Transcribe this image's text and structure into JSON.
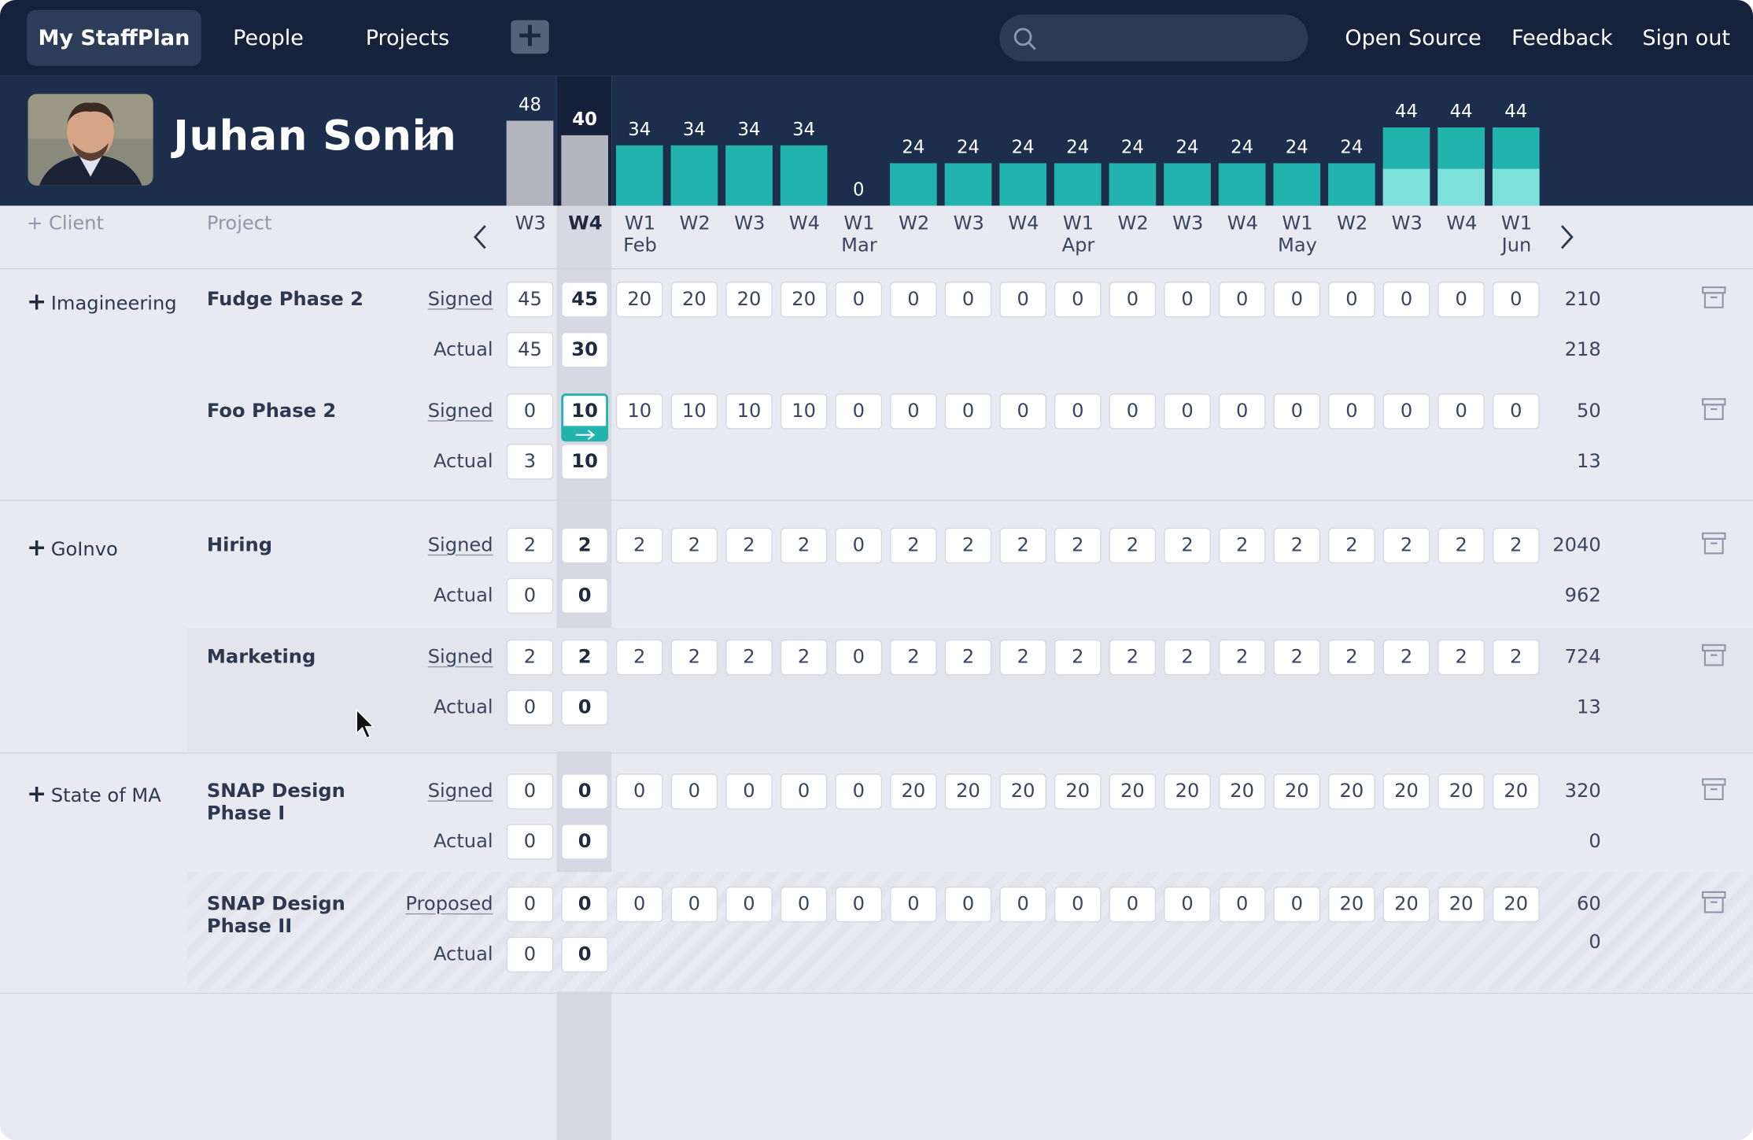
{
  "nav": {
    "home": "My StaffPlan",
    "people": "People",
    "projects": "Projects",
    "open_source": "Open Source",
    "feedback": "Feedback",
    "sign_out": "Sign out",
    "search_placeholder": ""
  },
  "user": {
    "name": "Juhan Sonin"
  },
  "weeks": [
    {
      "label": "W3",
      "month": "",
      "total": 48,
      "state": "past"
    },
    {
      "label": "W4",
      "month": "",
      "total": 40,
      "state": "current"
    },
    {
      "label": "W1",
      "month": "Feb",
      "total": 34,
      "state": "future"
    },
    {
      "label": "W2",
      "month": "",
      "total": 34,
      "state": "future"
    },
    {
      "label": "W3",
      "month": "",
      "total": 34,
      "state": "future"
    },
    {
      "label": "W4",
      "month": "",
      "total": 34,
      "state": "future"
    },
    {
      "label": "W1",
      "month": "Mar",
      "total": 0,
      "state": "future"
    },
    {
      "label": "W2",
      "month": "",
      "total": 24,
      "state": "future"
    },
    {
      "label": "W3",
      "month": "",
      "total": 24,
      "state": "future"
    },
    {
      "label": "W4",
      "month": "",
      "total": 24,
      "state": "future"
    },
    {
      "label": "W1",
      "month": "Apr",
      "total": 24,
      "state": "future"
    },
    {
      "label": "W2",
      "month": "",
      "total": 24,
      "state": "future"
    },
    {
      "label": "W3",
      "month": "",
      "total": 24,
      "state": "future"
    },
    {
      "label": "W4",
      "month": "",
      "total": 24,
      "state": "future"
    },
    {
      "label": "W1",
      "month": "May",
      "total": 24,
      "state": "future"
    },
    {
      "label": "W2",
      "month": "",
      "total": 24,
      "state": "future"
    },
    {
      "label": "W3",
      "month": "",
      "total": 44,
      "state": "proposed"
    },
    {
      "label": "W4",
      "month": "",
      "total": 44,
      "state": "proposed"
    },
    {
      "label": "W1",
      "month": "Jun",
      "total": 44,
      "state": "proposed"
    }
  ],
  "headers": {
    "client": "Client",
    "project": "Project"
  },
  "clients": [
    {
      "name": "Imagineering",
      "projects": [
        {
          "name": "Fudge Phase 2",
          "kind": "Signed",
          "values": [
            "45",
            "45",
            "20",
            "20",
            "20",
            "20",
            "0",
            "0",
            "0",
            "0",
            "0",
            "0",
            "0",
            "0",
            "0",
            "0",
            "0",
            "0",
            "0"
          ],
          "total": "210",
          "actual": [
            "45",
            "30"
          ],
          "actual_total": "218"
        },
        {
          "name": "Foo Phase 2",
          "kind": "Signed",
          "values": [
            "0",
            "10",
            "10",
            "10",
            "10",
            "10",
            "0",
            "0",
            "0",
            "0",
            "0",
            "0",
            "0",
            "0",
            "0",
            "0",
            "0",
            "0",
            "0"
          ],
          "total": "50",
          "actual": [
            "3",
            "10"
          ],
          "actual_total": "13"
        }
      ]
    },
    {
      "name": "GoInvo",
      "projects": [
        {
          "name": "Hiring",
          "kind": "Signed",
          "values": [
            "2",
            "2",
            "2",
            "2",
            "2",
            "2",
            "0",
            "2",
            "2",
            "2",
            "2",
            "2",
            "2",
            "2",
            "2",
            "2",
            "2",
            "2",
            "2"
          ],
          "total": "2040",
          "actual": [
            "0",
            "0"
          ],
          "actual_total": "962"
        },
        {
          "name": "Marketing",
          "kind": "Signed",
          "values": [
            "2",
            "2",
            "2",
            "2",
            "2",
            "2",
            "0",
            "2",
            "2",
            "2",
            "2",
            "2",
            "2",
            "2",
            "2",
            "2",
            "2",
            "2",
            "2"
          ],
          "total": "724",
          "actual": [
            "0",
            "0"
          ],
          "actual_total": "13"
        }
      ]
    },
    {
      "name": "State of MA",
      "projects": [
        {
          "name": "SNAP Design Phase I",
          "kind": "Signed",
          "values": [
            "0",
            "0",
            "0",
            "0",
            "0",
            "0",
            "0",
            "20",
            "20",
            "20",
            "20",
            "20",
            "20",
            "20",
            "20",
            "20",
            "20",
            "20",
            "20"
          ],
          "total": "320",
          "actual": [
            "0",
            "0"
          ],
          "actual_total": "0"
        },
        {
          "name": "SNAP Design Phase II",
          "kind": "Proposed",
          "values": [
            "0",
            "0",
            "0",
            "0",
            "0",
            "0",
            "0",
            "0",
            "0",
            "0",
            "0",
            "0",
            "0",
            "0",
            "0",
            "20",
            "20",
            "20",
            "20"
          ],
          "total": "60",
          "actual": [
            "0",
            "0"
          ],
          "actual_total": "0"
        }
      ]
    }
  ],
  "row_labels": {
    "actual": "Actual"
  },
  "colors": {
    "nav_bg": "#16223b",
    "header_bg": "#1d2e4c",
    "accent": "#22b3ae",
    "proposed": "#7de0db",
    "past": "#b3b4c0",
    "page_bg": "#e9eaf1"
  },
  "icons": {
    "search": "search-icon",
    "edit": "pencil-icon",
    "prev": "chevron-left-icon",
    "next": "chevron-right-icon",
    "archive": "archive-icon",
    "add": "plus-icon"
  }
}
